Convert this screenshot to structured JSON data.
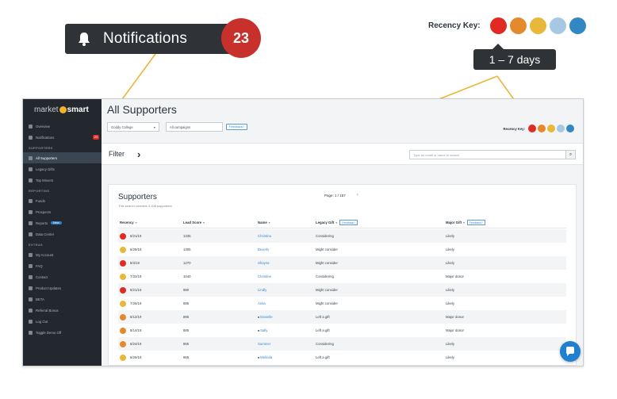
{
  "callout": {
    "notifications_label": "Notifications",
    "notifications_count": "23",
    "recency_key_label": "Recency Key:",
    "recency_days": "1 – 7 days"
  },
  "recency_colors": [
    "#e02a22",
    "#e58a2c",
    "#e8b83a",
    "#a6c8e3",
    "#3188c2"
  ],
  "brand": {
    "part1": "market",
    "part2": "smart"
  },
  "sidebar": {
    "items": [
      {
        "label": "Overview",
        "type": "item",
        "icon": "grid-icon"
      },
      {
        "label": "Notifications",
        "type": "item",
        "icon": "bell-icon",
        "badge": "23"
      },
      {
        "label": "SUPPORTERS",
        "type": "section"
      },
      {
        "label": "All Supporters",
        "type": "item",
        "icon": "users-icon",
        "active": true
      },
      {
        "label": "Legacy Gifts",
        "type": "item",
        "icon": "gift-icon"
      },
      {
        "label": "Top Movers",
        "type": "item",
        "icon": "arrow-up-icon"
      },
      {
        "label": "REPORTING",
        "type": "section"
      },
      {
        "label": "Funds",
        "type": "item",
        "icon": "chart-icon"
      },
      {
        "label": "Prospects",
        "type": "item",
        "icon": "flag-icon"
      },
      {
        "label": "Reports",
        "type": "item",
        "icon": "report-icon",
        "pill": "New"
      },
      {
        "label": "Data Center",
        "type": "item",
        "icon": "database-icon"
      },
      {
        "label": "EXTRAS",
        "type": "section"
      },
      {
        "label": "My Account",
        "type": "item",
        "icon": "user-icon"
      },
      {
        "label": "FAQ",
        "type": "item",
        "icon": "help-icon"
      },
      {
        "label": "Contact",
        "type": "item",
        "icon": "mail-icon"
      },
      {
        "label": "Product Updates",
        "type": "item",
        "icon": "info-icon"
      },
      {
        "label": "BETA",
        "type": "item",
        "icon": "beta-icon"
      },
      {
        "label": "Referral Bonus",
        "type": "item",
        "icon": "dollar-icon"
      },
      {
        "label": "Log Out",
        "type": "item",
        "icon": "logout-icon"
      },
      {
        "label": "Toggle Demo Off",
        "type": "item",
        "icon": "toggle-icon"
      }
    ]
  },
  "main": {
    "title": "All Supporters",
    "org_select": "Goddy College",
    "campaign_select": "All campaigns",
    "feedback_label": "Feedback?",
    "recency_key_label": "Recency Key:",
    "filter_label": "Filter",
    "search_placeholder": "Type an email or name to search"
  },
  "panel": {
    "title": "Supporters",
    "subtitle": "This search contains 3,108 supporters",
    "pager": "Page: 1 / 157",
    "columns": [
      "Recency",
      "Lead Score",
      "Name",
      "Legacy Gift",
      "Major Gift"
    ],
    "feedback_label": "Feedback?",
    "rows": [
      {
        "color": "#e02a22",
        "date": "8/21/19",
        "score": "1335",
        "name": "Christina",
        "legacy": "Considering",
        "major": "Likely"
      },
      {
        "color": "#e8b83a",
        "date": "6/28/19",
        "score": "1305",
        "name": "Beverly",
        "legacy": "Might consider",
        "major": "Likely"
      },
      {
        "color": "#e02a22",
        "date": "8/3/19",
        "score": "1270",
        "name": "Shayna",
        "legacy": "Might consider",
        "major": "Likely"
      },
      {
        "color": "#e8b83a",
        "date": "7/22/19",
        "score": "1040",
        "name": "Christine",
        "legacy": "Considering",
        "major": "Major donor"
      },
      {
        "color": "#e02a22",
        "date": "8/21/19",
        "score": "980",
        "name": "Lindly",
        "legacy": "Might consider",
        "major": "Likely"
      },
      {
        "color": "#e8b83a",
        "date": "7/26/19",
        "score": "885",
        "name": "Anita",
        "legacy": "Might consider",
        "major": "Likely"
      },
      {
        "color": "#e58a2c",
        "date": "8/12/19",
        "score": "885",
        "name": "Danielle",
        "legacy": "Left a gift",
        "major": "Major donor",
        "name_icon": true
      },
      {
        "color": "#e58a2c",
        "date": "8/14/19",
        "score": "885",
        "name": "Sally",
        "legacy": "Left a gift",
        "major": "Major donor",
        "name_icon": true
      },
      {
        "color": "#e58a2c",
        "date": "8/24/19",
        "score": "865",
        "name": "Summer",
        "legacy": "Considering",
        "major": "Likely"
      },
      {
        "color": "#e8b83a",
        "date": "6/26/19",
        "score": "865",
        "name": "Melinda",
        "legacy": "Left a gift",
        "major": "Likely",
        "name_icon": true
      }
    ]
  }
}
